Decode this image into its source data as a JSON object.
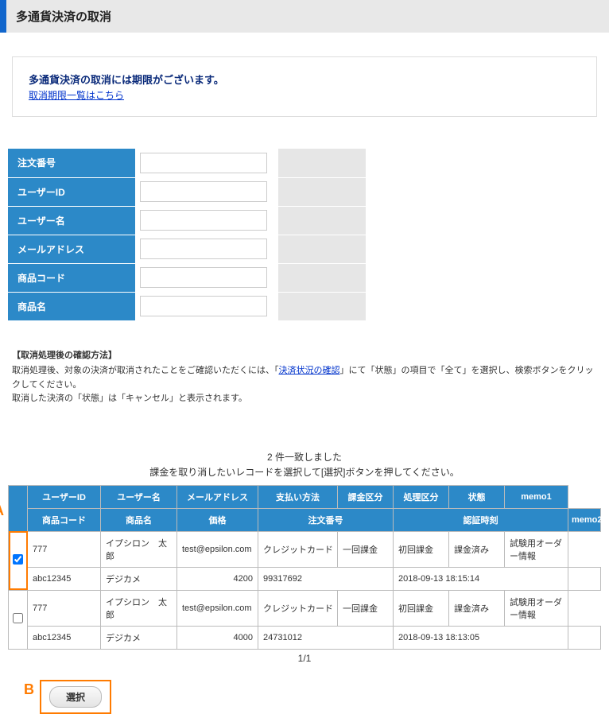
{
  "page_title": "多通貨決済の取消",
  "notice": {
    "title": "多通貨決済の取消には期限がございます。",
    "link_text": "取消期限一覧はこちら"
  },
  "search_form": {
    "fields": [
      {
        "label": "注文番号",
        "value": ""
      },
      {
        "label": "ユーザーID",
        "value": ""
      },
      {
        "label": "ユーザー名",
        "value": ""
      },
      {
        "label": "メールアドレス",
        "value": ""
      },
      {
        "label": "商品コード",
        "value": ""
      },
      {
        "label": "商品名",
        "value": ""
      }
    ]
  },
  "instructions": {
    "title": "【取消処理後の確認方法】",
    "line1_pre": "取消処理後、対象の決済が取消されたことをご確認いただくには、「",
    "line1_link": "決済状況の確認",
    "line1_post": "」にて「状態」の項目で「全て」を選択し、検索ボタンをクリックしてください。",
    "line2": "取消した決済の「状態」は「キャンセル」と表示されます。"
  },
  "result_count_text": "2 件一致しました",
  "result_hint": "課金を取り消したいレコードを選択して[選択]ボタンを押してください。",
  "annotations": {
    "a": "A",
    "b": "B"
  },
  "table_headers": {
    "row1": [
      "",
      "ユーザーID",
      "ユーザー名",
      "メールアドレス",
      "支払い方法",
      "課金区分",
      "処理区分",
      "状態",
      "memo1"
    ],
    "row2": [
      "商品コード",
      "商品名",
      "価格",
      "注文番号",
      "認証時刻",
      "memo2"
    ]
  },
  "records": [
    {
      "checked": true,
      "user_id": "777",
      "user_name": "イプシロン　太郎",
      "mail": "test@epsilon.com",
      "pay_method": "クレジットカード",
      "charge_type": "一回課金",
      "process_type": "初回課金",
      "status": "課金済み",
      "memo1": "試験用オーダー情報",
      "product_code": "abc12345",
      "product_name": "デジカメ",
      "price": "4200",
      "order_no": "99317692",
      "auth_time": "2018-09-13 18:15:14",
      "memo2": ""
    },
    {
      "checked": false,
      "user_id": "777",
      "user_name": "イプシロン　太郎",
      "mail": "test@epsilon.com",
      "pay_method": "クレジットカード",
      "charge_type": "一回課金",
      "process_type": "初回課金",
      "status": "課金済み",
      "memo1": "試験用オーダー情報",
      "product_code": "abc12345",
      "product_name": "デジカメ",
      "price": "4000",
      "order_no": "24731012",
      "auth_time": "2018-09-13 18:13:05",
      "memo2": ""
    }
  ],
  "pager": "1/1",
  "select_button_label": "選択"
}
